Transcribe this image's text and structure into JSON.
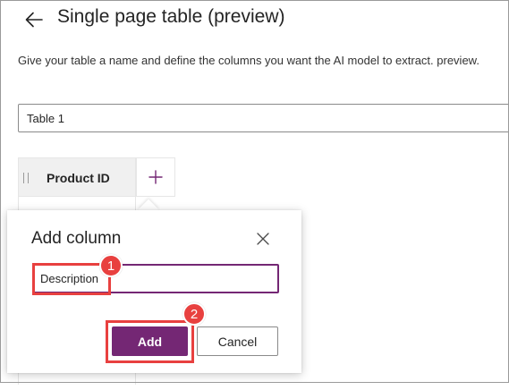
{
  "header": {
    "back_icon": "arrow-left-icon",
    "title": "Single page table (preview)"
  },
  "description": "Give your table a name and define the columns you want the AI model to extract. preview.",
  "table_name": {
    "value": "Table 1"
  },
  "table": {
    "columns": [
      {
        "label": "Product ID"
      }
    ],
    "add_column_icon": "plus-icon"
  },
  "add_column_dialog": {
    "title": "Add column",
    "close_icon": "close-icon",
    "input_value": "Description",
    "add_label": "Add",
    "cancel_label": "Cancel"
  },
  "annotations": {
    "step1": "1",
    "step2": "2"
  },
  "colors": {
    "accent": "#742774",
    "annotation": "#e8403f",
    "header_bg": "#f0f0f0"
  }
}
